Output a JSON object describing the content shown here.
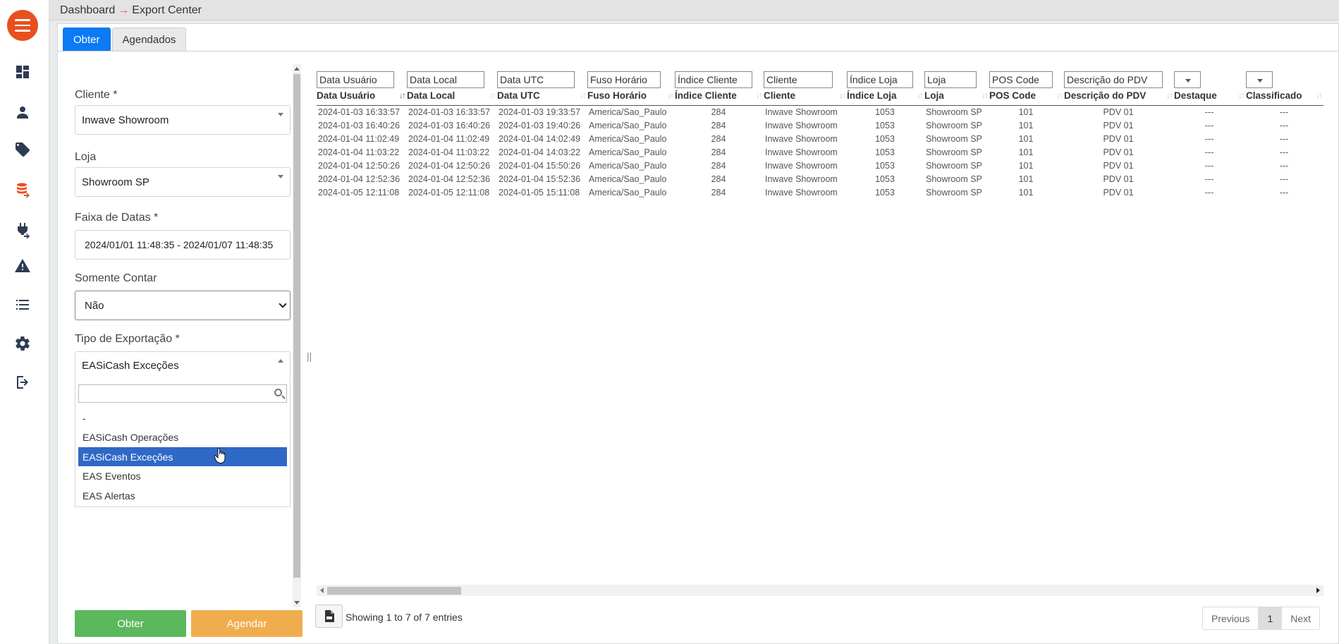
{
  "breadcrumb": {
    "root": "Dashboard",
    "separator": "→",
    "current": "Export Center"
  },
  "tabs": [
    {
      "label": "Obter",
      "active": true
    },
    {
      "label": "Agendados",
      "active": false
    }
  ],
  "form": {
    "cliente": {
      "label": "Cliente *",
      "value": "Inwave Showroom"
    },
    "loja": {
      "label": "Loja",
      "value": "Showroom SP"
    },
    "faixa_datas": {
      "label": "Faixa de Datas *",
      "value": "2024/01/01 11:48:35 - 2024/01/07 11:48:35"
    },
    "somente_contar": {
      "label": "Somente Contar",
      "value": "Não"
    },
    "tipo_exportacao": {
      "label": "Tipo de Exportação *",
      "value": "EASiCash Exceções",
      "search_placeholder": "",
      "options": [
        "-",
        "EASiCash Operações",
        "EASiCash Exceções",
        "EAS Eventos",
        "EAS Alertas"
      ],
      "selected_index": 2
    }
  },
  "buttons": {
    "obter": "Obter",
    "agendar": "Agendar"
  },
  "table": {
    "filters": [
      "Data Usuário",
      "Data Local",
      "Data UTC",
      "Fuso Horário",
      "Índice Cliente",
      "Cliente",
      "Índice Loja",
      "Loja",
      "POS Code",
      "Descrição do PDV",
      "",
      ""
    ],
    "columns": [
      "Data Usuário",
      "Data Local",
      "Data UTC",
      "Fuso Horário",
      "Índice Cliente",
      "Cliente",
      "Índice Loja",
      "Loja",
      "POS Code",
      "Descrição do PDV",
      "Destaque",
      "Classificado"
    ],
    "sort_icon": "↓↑",
    "rows": [
      [
        "2024-01-03 16:33:57",
        "2024-01-03 16:33:57",
        "2024-01-03 19:33:57",
        "America/Sao_Paulo",
        "284",
        "Inwave Showroom",
        "1053",
        "Showroom SP",
        "101",
        "PDV 01",
        "---",
        "---"
      ],
      [
        "2024-01-03 16:40:26",
        "2024-01-03 16:40:26",
        "2024-01-03 19:40:26",
        "America/Sao_Paulo",
        "284",
        "Inwave Showroom",
        "1053",
        "Showroom SP",
        "101",
        "PDV 01",
        "---",
        "---"
      ],
      [
        "2024-01-04 11:02:49",
        "2024-01-04 11:02:49",
        "2024-01-04 14:02:49",
        "America/Sao_Paulo",
        "284",
        "Inwave Showroom",
        "1053",
        "Showroom SP",
        "101",
        "PDV 01",
        "---",
        "---"
      ],
      [
        "2024-01-04 11:03:22",
        "2024-01-04 11:03:22",
        "2024-01-04 14:03:22",
        "America/Sao_Paulo",
        "284",
        "Inwave Showroom",
        "1053",
        "Showroom SP",
        "101",
        "PDV 01",
        "---",
        "---"
      ],
      [
        "2024-01-04 12:50:26",
        "2024-01-04 12:50:26",
        "2024-01-04 15:50:26",
        "America/Sao_Paulo",
        "284",
        "Inwave Showroom",
        "1053",
        "Showroom SP",
        "101",
        "PDV 01",
        "---",
        "---"
      ],
      [
        "2024-01-04 12:52:36",
        "2024-01-04 12:52:36",
        "2024-01-04 15:52:36",
        "America/Sao_Paulo",
        "284",
        "Inwave Showroom",
        "1053",
        "Showroom SP",
        "101",
        "PDV 01",
        "---",
        "---"
      ],
      [
        "2024-01-05 12:11:08",
        "2024-01-05 12:11:08",
        "2024-01-05 15:11:08",
        "America/Sao_Paulo",
        "284",
        "Inwave Showroom",
        "1053",
        "Showroom SP",
        "101",
        "PDV 01",
        "---",
        "---"
      ]
    ],
    "info": "Showing 1 to 7 of 7 entries"
  },
  "pagination": {
    "previous": "Previous",
    "current": "1",
    "next": "Next"
  },
  "sidebar_icons": [
    "dashboard-icon",
    "user-icon",
    "tag-icon",
    "database-export-icon",
    "plug-icon",
    "warning-icon",
    "list-icon",
    "gear-icon",
    "logout-icon"
  ],
  "colors": {
    "brand": "#e8501e",
    "tab_active": "#0b7af5",
    "obter": "#5cb85c",
    "agendar": "#f0ad4e",
    "option_selected": "#2f69c6",
    "sidebar_icon": "#2e3b52"
  }
}
